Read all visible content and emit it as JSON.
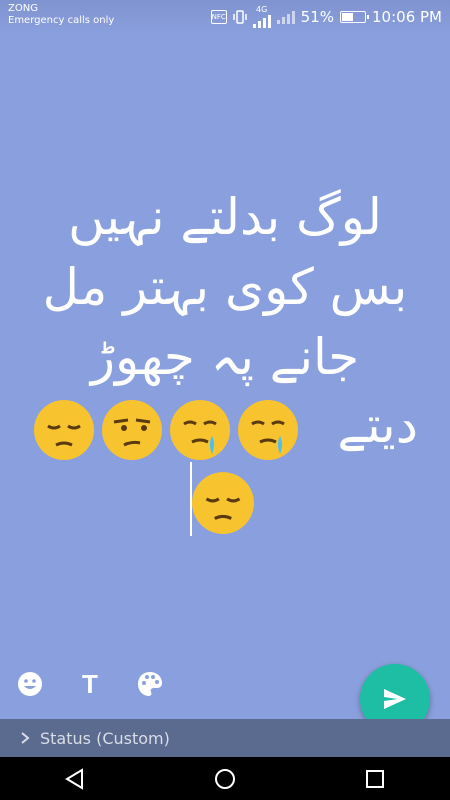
{
  "status_bar": {
    "carrier": "ZONG",
    "carrier_sub": "Emergency calls only",
    "nfc": "NFC",
    "network": "4G",
    "battery_text": "51%",
    "battery_level": 0.51,
    "time": "10:06 PM"
  },
  "status": {
    "line1": "لوگ بدلتے نہیں",
    "line2": "بس کوی بہتر مل",
    "line3": "جانے پہ چھوڑ",
    "line4_word": "دیتے",
    "emojis": [
      "pensive-face",
      "unamused-face",
      "crying-face",
      "crying-face",
      "pensive-face"
    ]
  },
  "toolbar": {
    "emoji_icon": "smiley-icon",
    "text_icon_label": "T",
    "palette_icon": "palette-icon"
  },
  "caption": {
    "label": "Status (Custom)"
  },
  "colors": {
    "background": "#8a9fdd",
    "send_button": "#1ebea5",
    "caption_bar": "#5a6b8f"
  }
}
